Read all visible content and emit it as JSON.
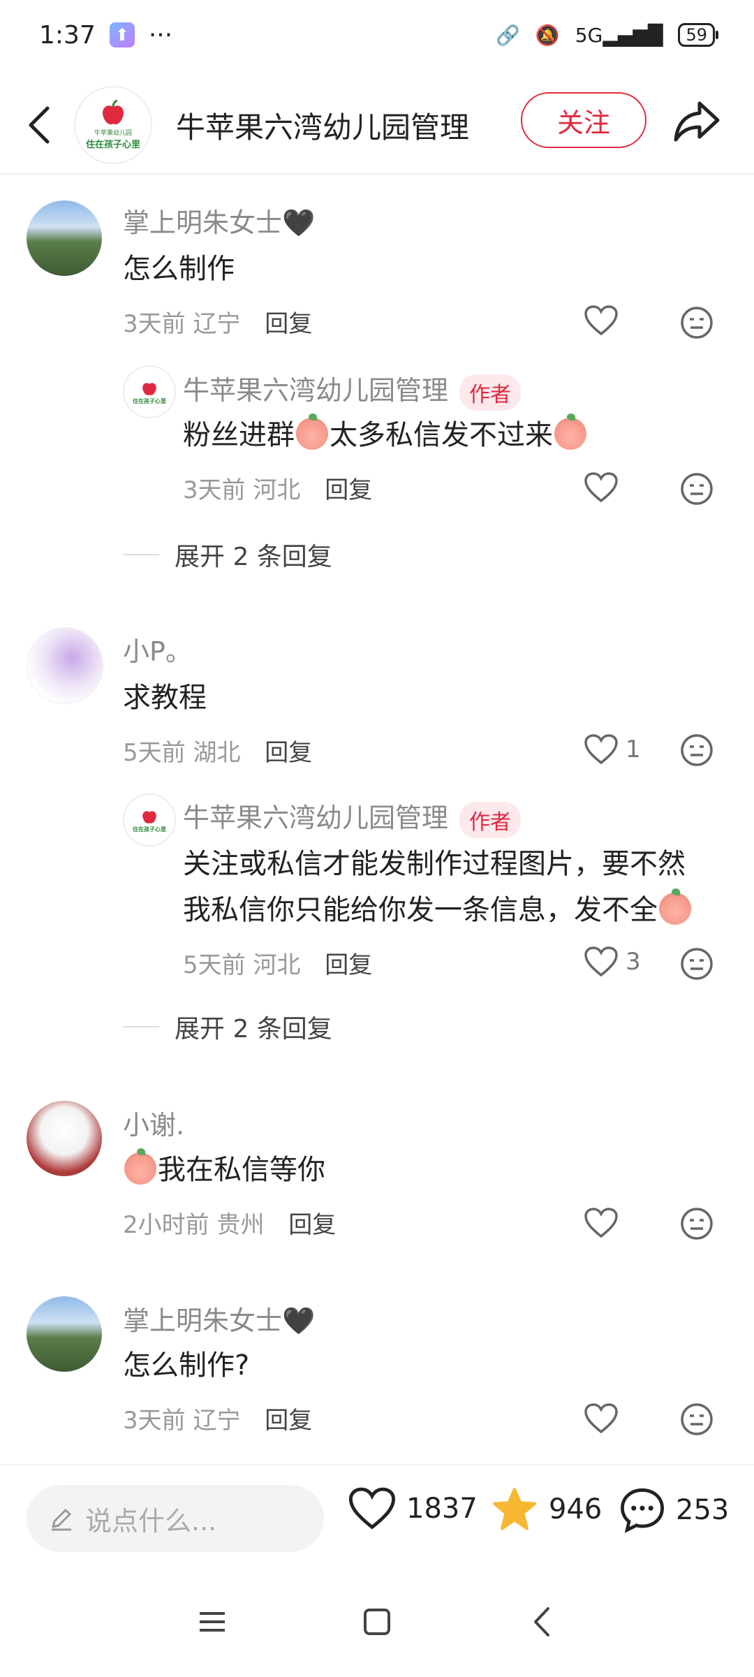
{
  "status_bar": {
    "time": "1:37",
    "dots": "···",
    "network": "5G",
    "battery": "59"
  },
  "header": {
    "title": "牛苹果六湾幼儿园管理",
    "follow_label": "关注",
    "avatar_line1": "牛苹果幼儿园",
    "avatar_line2": "住在孩子心里"
  },
  "comments": [
    {
      "user": "掌上明朱女士🖤",
      "text": "怎么制作",
      "time": "3天前",
      "location": "辽宁",
      "reply_label": "回复",
      "likes": "",
      "reply": {
        "user": "牛苹果六湾幼儿园管理",
        "author_tag": "作者",
        "text_before": "粉丝进群",
        "text_middle": "太多私信发不过来",
        "time": "3天前",
        "location": "河北",
        "reply_label": "回复",
        "likes": ""
      },
      "expand_label": "展开 2 条回复"
    },
    {
      "user": "小P。",
      "text": "求教程",
      "time": "5天前",
      "location": "湖北",
      "reply_label": "回复",
      "likes": "1",
      "reply": {
        "user": "牛苹果六湾幼儿园管理",
        "author_tag": "作者",
        "text_line1": "关注或私信才能发制作过程图片，要不然",
        "text_line2": "我私信你只能给你发一条信息，发不全",
        "time": "5天前",
        "location": "河北",
        "reply_label": "回复",
        "likes": "3"
      },
      "expand_label": "展开 2 条回复"
    },
    {
      "user": "小谢.",
      "text": "我在私信等你",
      "time": "2小时前",
      "location": "贵州",
      "reply_label": "回复",
      "likes": ""
    },
    {
      "user": "掌上明朱女士🖤",
      "text": "怎么制作?",
      "time": "3天前",
      "location": "辽宁",
      "reply_label": "回复",
      "likes": ""
    }
  ],
  "bottom_bar": {
    "input_placeholder": "说点什么...",
    "likes": "1837",
    "favorites": "946",
    "comments": "253"
  },
  "colors": {
    "accent": "#e0283f",
    "star": "#f7b731"
  }
}
